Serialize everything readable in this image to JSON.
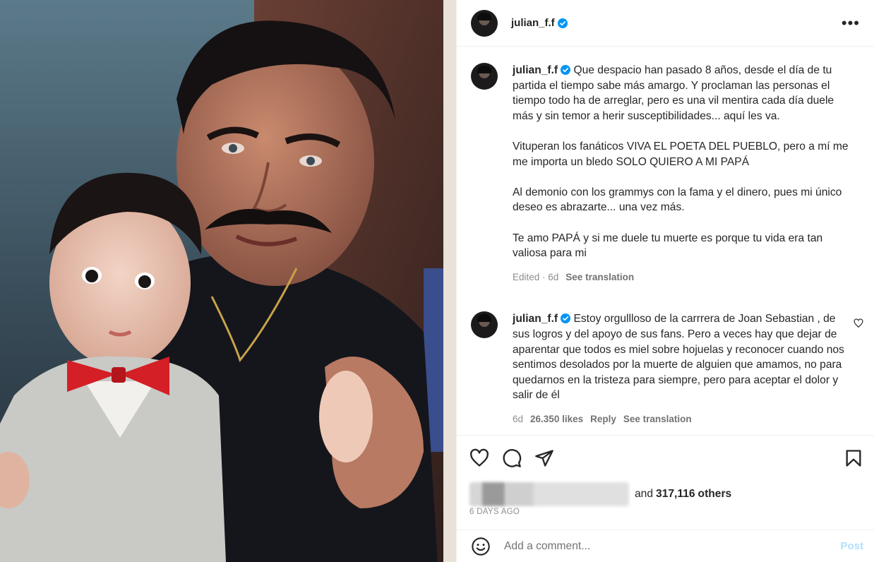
{
  "post": {
    "author": "julian_f.f",
    "more_label": "•••"
  },
  "caption": {
    "username": "julian_f.f",
    "text": "Que despacio han pasado 8 años, desde el día de tu partida el tiempo sabe más amargo. Y proclaman las personas el tiempo todo ha de arreglar, pero es una vil mentira cada día duele más y sin temor a herir susceptibilidades... aquí les va.\n\nVituperan los fanáticos VIVA EL POETA DEL PUEBLO, pero a mí me me importa un bledo SOLO QUIERO A MI PAPÁ\n\nAl demonio con los grammys con la fama y el dinero, pues mi único deseo es abrazarte... una vez más.\n\nTe amo PAPÁ y si me duele tu muerte es porque tu vida era tan valiosa para mi",
    "edited": "Edited · 6d",
    "see_translation": "See translation"
  },
  "comments": [
    {
      "username": "julian_f.f",
      "text": "Estoy orgullloso de la carrrera de Joan Sebastian , de sus logros y del apoyo de sus fans. Pero a veces hay que dejar de aparentar que todos es miel sobre hojuelas y reconocer cuando nos sentimos desolados por la muerte de alguien que amamos, no para quedarnos en la tristeza para siempre, pero para aceptar el dolor y salir de él",
      "time": "6d",
      "likes": "26.350 likes",
      "reply": "Reply",
      "see_translation": "See translation"
    }
  ],
  "engagement": {
    "likes_prefix": "and",
    "likes_count": "317,116",
    "likes_suffix": "others",
    "date": "6 DAYS AGO"
  },
  "composer": {
    "placeholder": "Add a comment...",
    "post_label": "Post"
  },
  "icons": {
    "verified": "verified-badge-icon",
    "like": "heart-icon",
    "comment": "comment-icon",
    "share": "share-icon",
    "save": "bookmark-icon",
    "emoji": "emoji-icon"
  },
  "colors": {
    "verified": "#0095f6",
    "post_button": "#b2dffc",
    "muted_text": "#8e8e8e"
  }
}
